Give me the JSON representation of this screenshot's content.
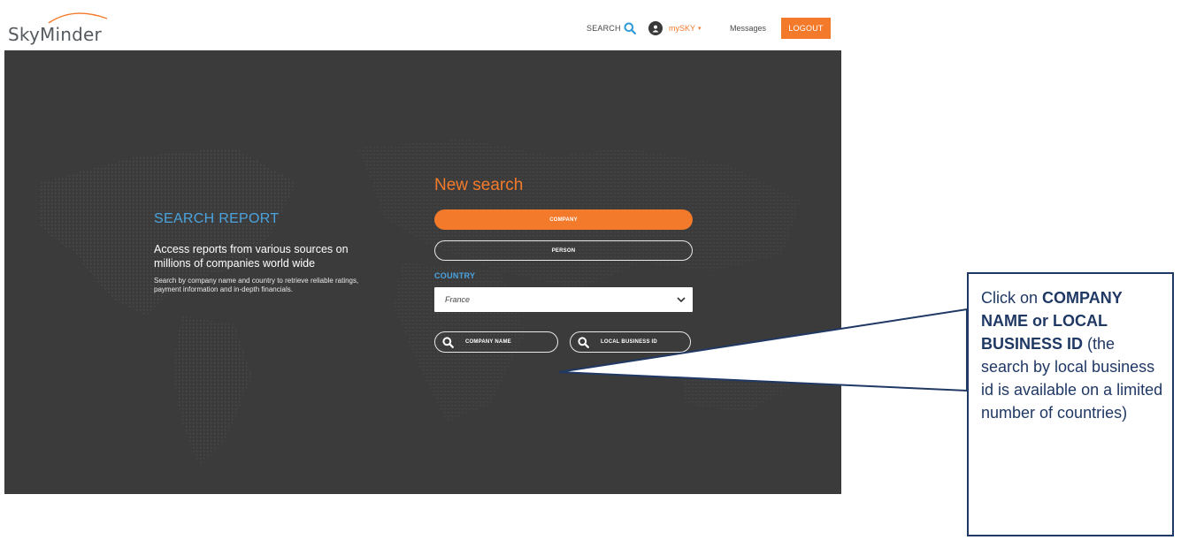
{
  "header": {
    "logo_text": "SkyMinder",
    "search_label": "SEARCH",
    "user_menu_label": "mySKY",
    "messages_label": "Messages",
    "logout_label": "LOGOUT"
  },
  "hero": {
    "report_title": "SEARCH REPORT",
    "report_subtitle": "Access reports from various sources on millions of companies world wide",
    "report_description": "Search by company name and country to retrieve reliable ratings, payment information and in-depth financials."
  },
  "new_search": {
    "title": "New search",
    "company_button": "COMPANY",
    "person_button": "PERSON",
    "country_label": "COUNTRY",
    "country_value": "France",
    "company_name_button": "COMPANY NAME",
    "local_business_id_button": "LOCAL BUSINESS ID"
  },
  "callout": {
    "prefix": "Click on ",
    "bold": "COMPANY NAME or LOCAL BUSINESS ID",
    "suffix": " (the search by local business id is available on a limited number of countries)"
  },
  "colors": {
    "accent_orange": "#f47a2b",
    "accent_blue": "#4aa3df",
    "hero_background": "#3b3b3b",
    "callout_border": "#1f3864"
  }
}
